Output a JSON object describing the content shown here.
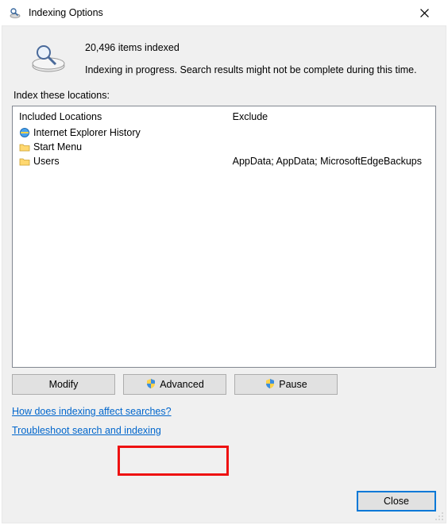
{
  "window": {
    "title": "Indexing Options"
  },
  "status": {
    "count_line": "20,496 items indexed",
    "progress_line": "Indexing in progress. Search results might not be complete during this time."
  },
  "section_label": "Index these locations:",
  "columns": {
    "included_header": "Included Locations",
    "exclude_header": "Exclude"
  },
  "rows": [
    {
      "name": "Internet Explorer History",
      "icon": "ie",
      "exclude": ""
    },
    {
      "name": "Start Menu",
      "icon": "folder",
      "exclude": ""
    },
    {
      "name": "Users",
      "icon": "folder",
      "exclude": "AppData; AppData; MicrosoftEdgeBackups"
    }
  ],
  "buttons": {
    "modify": "Modify",
    "advanced": "Advanced",
    "pause": "Pause",
    "close": "Close"
  },
  "links": {
    "how": "How does indexing affect searches?",
    "troubleshoot": "Troubleshoot search and indexing"
  }
}
